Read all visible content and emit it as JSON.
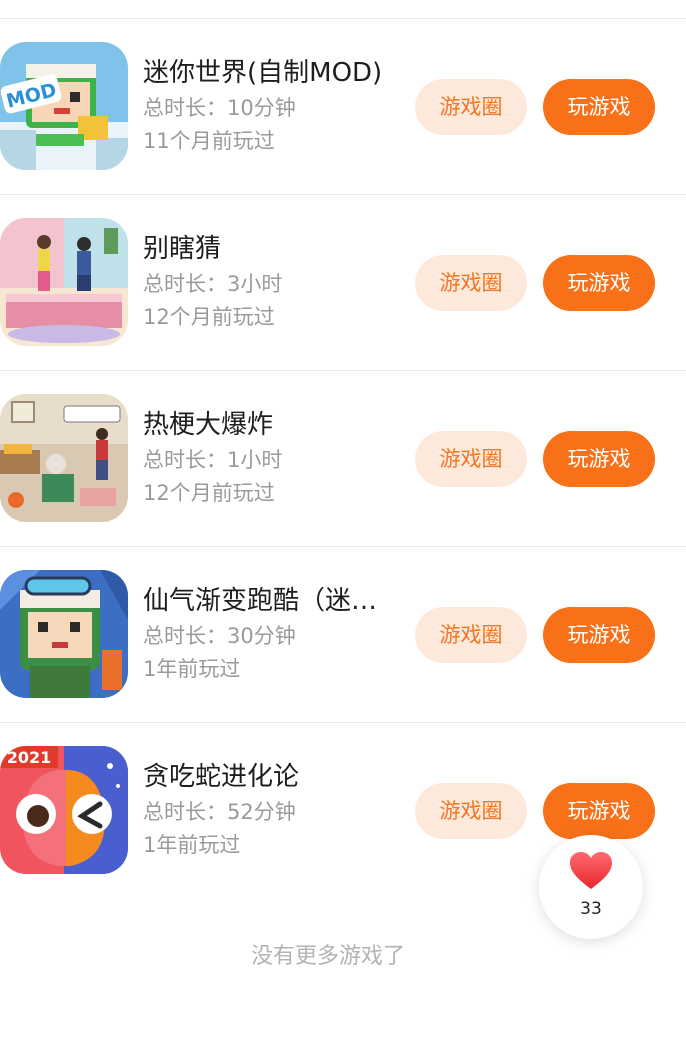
{
  "games": [
    {
      "title": "迷你世界(自制MOD)",
      "duration": "总时长：10分钟",
      "last_played": "11个月前玩过",
      "icon": "mini-world-mod-icon",
      "icon_text": "MOD",
      "circle_label": "游戏圈",
      "play_label": "玩游戏"
    },
    {
      "title": "别瞎猜",
      "duration": "总时长：3小时",
      "last_played": "12个月前玩过",
      "icon": "bie-xia-cai-icon",
      "circle_label": "游戏圈",
      "play_label": "玩游戏"
    },
    {
      "title": "热梗大爆炸",
      "duration": "总时长：1小时",
      "last_played": "12个月前玩过",
      "icon": "re-geng-da-bao-zha-icon",
      "circle_label": "游戏圈",
      "play_label": "玩游戏"
    },
    {
      "title": "仙气渐变跑酷（迷…",
      "duration": "总时长：30分钟",
      "last_played": "1年前玩过",
      "icon": "xian-qi-parkour-icon",
      "circle_label": "游戏圈",
      "play_label": "玩游戏"
    },
    {
      "title": "贪吃蛇进化论",
      "duration": "总时长：52分钟",
      "last_played": "1年前玩过",
      "icon": "snake-evolution-icon",
      "icon_text": "2021",
      "circle_label": "游戏圈",
      "play_label": "玩游戏"
    }
  ],
  "like": {
    "icon": "heart-icon",
    "count": "33"
  },
  "footer": {
    "end_text": "没有更多游戏了"
  },
  "colors": {
    "accent": "#f87118",
    "accent_soft": "#fde9db",
    "accent_text": "#f27524",
    "heart": "#f23a3f",
    "muted_text": "#9a9a9a"
  }
}
